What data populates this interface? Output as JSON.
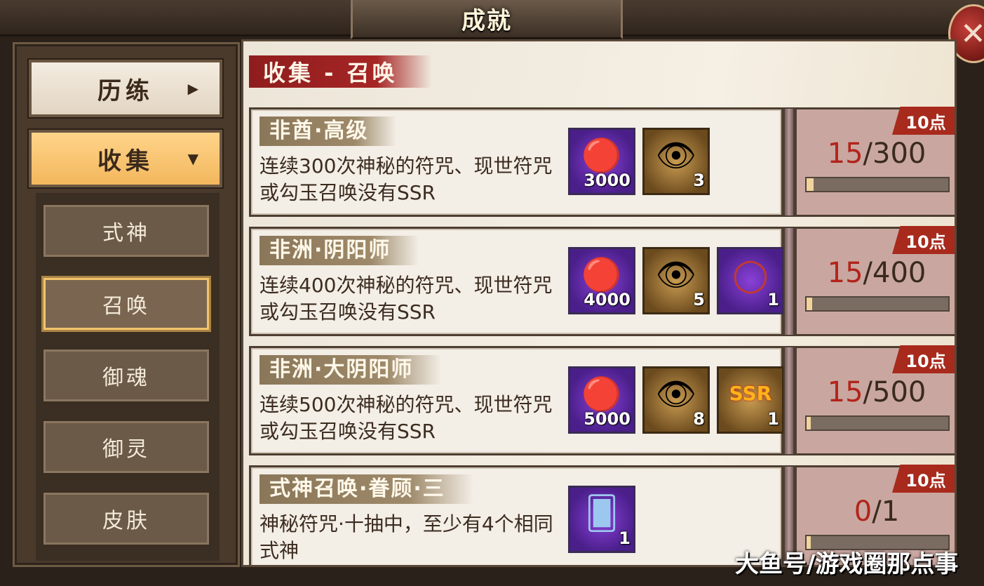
{
  "header": {
    "title": "成就",
    "close_icon": "close-icon"
  },
  "sidebar": {
    "categories": [
      {
        "label": "历练",
        "arrow": "▶"
      },
      {
        "label": "收集",
        "arrow": "▼"
      }
    ],
    "sub_items": [
      {
        "label": "式神"
      },
      {
        "label": "召唤",
        "active": true
      },
      {
        "label": "御魂"
      },
      {
        "label": "御灵"
      },
      {
        "label": "皮肤"
      }
    ]
  },
  "main": {
    "section_title": "收集 - 召唤",
    "cards": [
      {
        "name": "非酋·高级",
        "desc": "连续300次神秘的符咒、现世符咒或勾玉召唤没有SSR",
        "rewards": [
          {
            "icon": "magatama-icon",
            "glyph": "🔴",
            "qty": "3000"
          },
          {
            "icon": "daruma-icon",
            "glyph": "👁",
            "qty": "3"
          }
        ],
        "points": "10点",
        "progress_current": "15",
        "progress_total": "/300",
        "progress_fraction": 0.05
      },
      {
        "name": "非洲·阴阳师",
        "desc": "连续400次神秘的符咒、现世符咒或勾玉召唤没有SSR",
        "rewards": [
          {
            "icon": "magatama-icon",
            "glyph": "🔴",
            "qty": "4000"
          },
          {
            "icon": "daruma-icon",
            "glyph": "👁",
            "qty": "5"
          },
          {
            "icon": "frame-icon",
            "glyph": "◯",
            "qty": "1"
          }
        ],
        "points": "10点",
        "progress_current": "15",
        "progress_total": "/400",
        "progress_fraction": 0.0375
      },
      {
        "name": "非洲·大阴阳师",
        "desc": "连续500次神秘的符咒、现世符咒或勾玉召唤没有SSR",
        "rewards": [
          {
            "icon": "magatama-icon",
            "glyph": "🔴",
            "qty": "5000"
          },
          {
            "icon": "daruma-icon",
            "glyph": "👁",
            "qty": "8"
          },
          {
            "icon": "ssr-icon",
            "glyph": "SSR",
            "qty": "1"
          }
        ],
        "points": "10点",
        "progress_current": "15",
        "progress_total": "/500",
        "progress_fraction": 0.03
      },
      {
        "name": "式神召唤·眷顾·三",
        "desc": "神秘符咒·十抽中，至少有4个相同式神",
        "rewards": [
          {
            "icon": "talisman-icon",
            "glyph": "🂠",
            "qty": "1"
          }
        ],
        "points": "10点",
        "progress_current": "0",
        "progress_total": "/1",
        "progress_fraction": 0
      }
    ]
  },
  "watermark": "大鱼号/游戏圈那点事",
  "colors": {
    "accent_red": "#a72a1d",
    "panel_brown": "#4a3a2c",
    "active_tab": "#f3b75d"
  }
}
